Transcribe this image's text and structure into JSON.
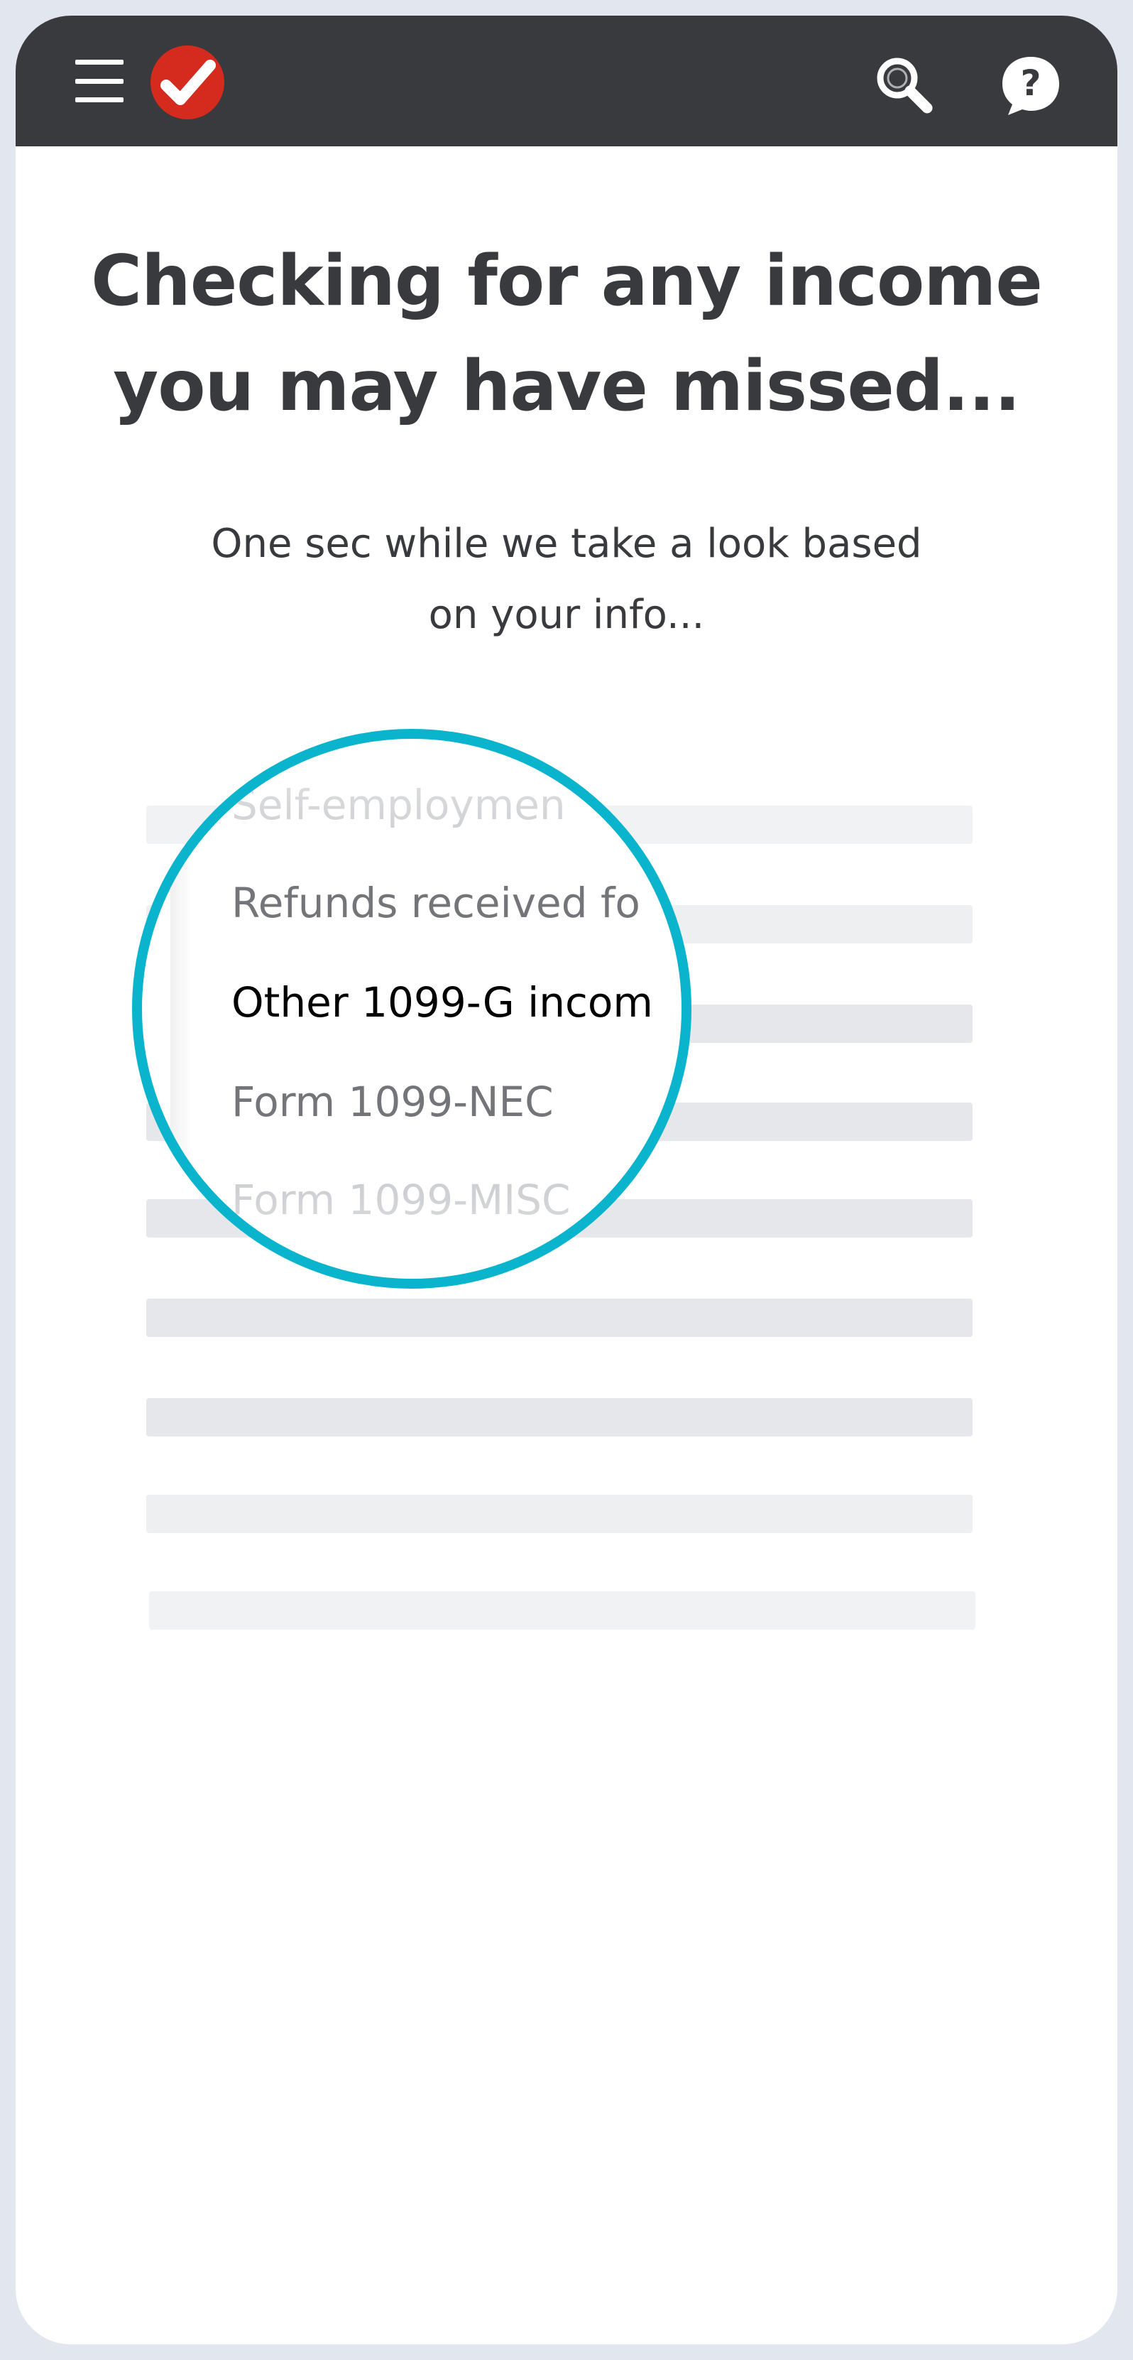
{
  "header": {
    "menu_icon": "hamburger-menu-icon",
    "logo_icon": "turbotax-checkmark-logo",
    "search_icon": "search-icon",
    "help_icon": "help-question-icon",
    "bar_color": "#393a3d",
    "logo_color": "#d52b1e"
  },
  "main": {
    "title_line1": "Checking for any income",
    "title_line2": "you may have missed...",
    "subtitle_line1": "One sec while we take a look based",
    "subtitle_line2": "on your info..."
  },
  "magnifier": {
    "ring_color": "#0ab4cc",
    "items": [
      {
        "label": "Self-employmen"
      },
      {
        "label": "Refunds received fo"
      },
      {
        "label": "Other 1099-G incom"
      },
      {
        "label": "Form 1099-NEC"
      },
      {
        "label": "Form 1099-MISC"
      }
    ]
  }
}
